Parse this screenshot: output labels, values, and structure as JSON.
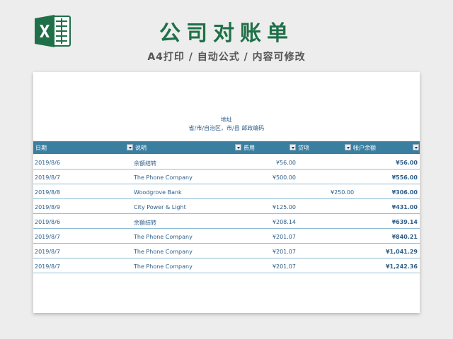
{
  "header": {
    "title": "公司对账单",
    "subtitle": "A4打印 / 自动公式 / 内容可修改"
  },
  "sheet": {
    "address_label": "地址",
    "address_line": "省/市/自治区，市/县  邮政编码",
    "columns": [
      "日期",
      "说明",
      "费用",
      "贷项",
      "帐户余额"
    ],
    "rows": [
      {
        "date": "2019/8/6",
        "desc": "余额结转",
        "fee": "¥56.00",
        "pay": "",
        "bal": "¥56.00"
      },
      {
        "date": "2019/8/7",
        "desc": "The Phone Company",
        "fee": "¥500.00",
        "pay": "",
        "bal": "¥556.00"
      },
      {
        "date": "2019/8/8",
        "desc": "Woodgrove Bank",
        "fee": "",
        "pay": "¥250.00",
        "bal": "¥306.00"
      },
      {
        "date": "2019/8/9",
        "desc": "City Power & Light",
        "fee": "¥125.00",
        "pay": "",
        "bal": "¥431.00"
      },
      {
        "date": "2019/8/6",
        "desc": "余额结转",
        "fee": "¥208.14",
        "pay": "",
        "bal": "¥639.14"
      },
      {
        "date": "2019/8/7",
        "desc": "The Phone Company",
        "fee": "¥201.07",
        "pay": "",
        "bal": "¥840.21"
      },
      {
        "date": "2019/8/7",
        "desc": "The Phone Company",
        "fee": "¥201.07",
        "pay": "",
        "bal": "¥1,041.29"
      },
      {
        "date": "2019/8/7",
        "desc": "The Phone Company",
        "fee": "¥201.07",
        "pay": "",
        "bal": "¥1,242.36"
      }
    ]
  },
  "icons": {
    "logo": "excel-logo-icon"
  },
  "colors": {
    "brand": "#1f7048",
    "header_bg": "#3a7fa0",
    "text": "#2e5f8a"
  }
}
